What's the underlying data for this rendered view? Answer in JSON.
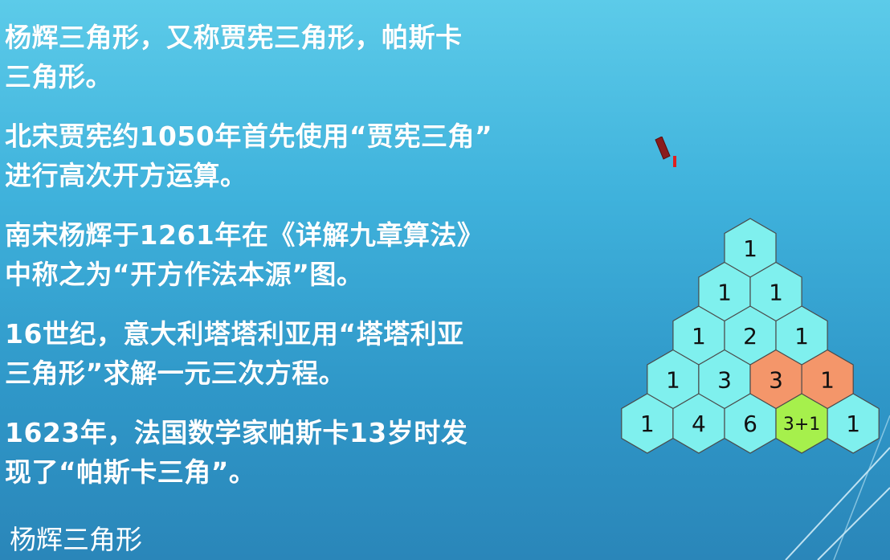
{
  "paragraphs": [
    [
      "杨辉三角形，又称贾宪三角形，帕斯卡",
      "三角形。"
    ],
    [
      "北宋贾宪约1050年首先使用“贾宪三角”",
      "进行高次开方运算。"
    ],
    [
      "南宋杨辉于1261年在《详解九章算法》",
      "中称之为“开方作法本源”图。"
    ],
    [
      "16世纪，意大利塔塔利亚用“塔塔利亚",
      "三角形”求解一元三次方程。"
    ],
    [
      "1623年，法国数学家帕斯卡13岁时发",
      "现了“帕斯卡三角”。"
    ]
  ],
  "footer_title": "杨辉三角形",
  "triangle": {
    "rows": [
      [
        "1"
      ],
      [
        "1",
        "1"
      ],
      [
        "1",
        "2",
        "1"
      ],
      [
        "1",
        "3",
        "3",
        "1"
      ],
      [
        "1",
        "4",
        "6",
        "3+1",
        "1"
      ]
    ],
    "colors": {
      "default": "#7ff0ee",
      "highlight_orange": "#f4966a",
      "highlight_green": "#a6f04c",
      "stroke": "#4a4a4a"
    },
    "highlighted": {
      "orange": [
        [
          3,
          2
        ],
        [
          3,
          3
        ]
      ],
      "green": [
        [
          4,
          3
        ]
      ]
    }
  }
}
